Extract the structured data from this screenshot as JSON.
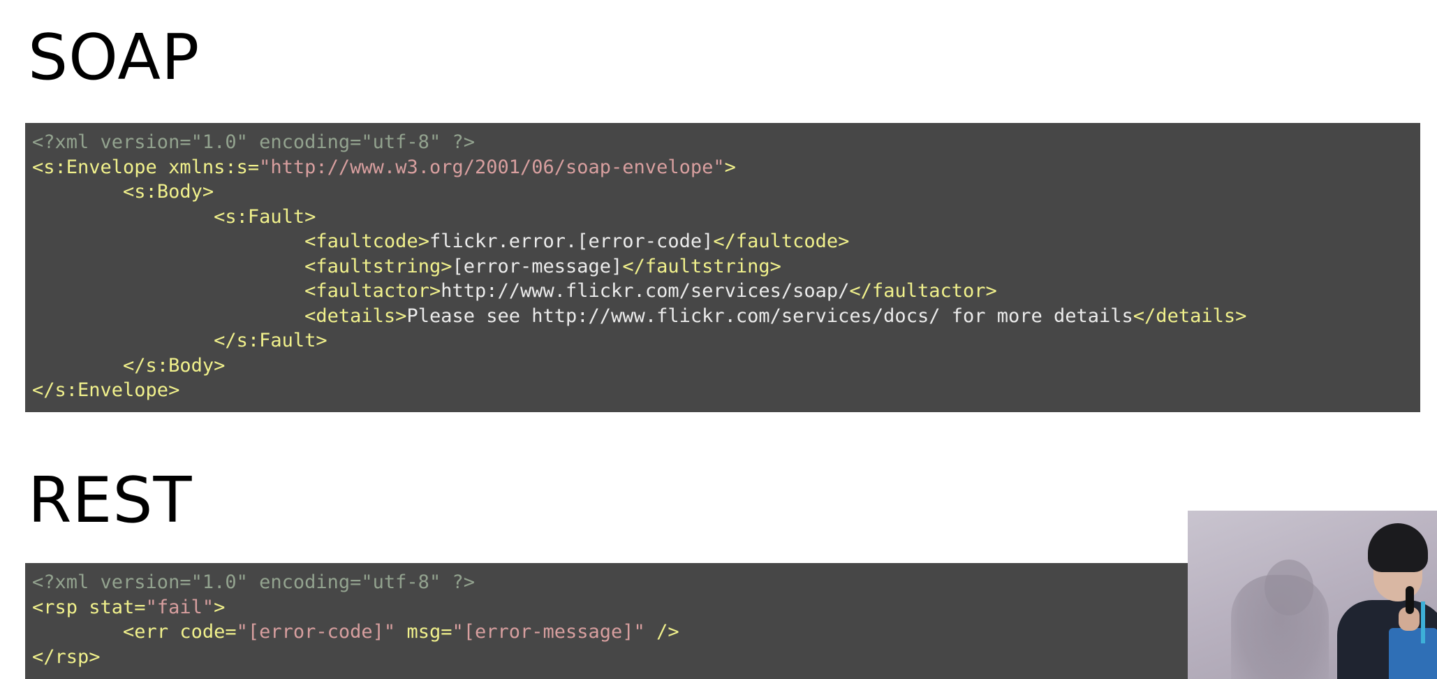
{
  "slide": {
    "soap_title": "SOAP",
    "rest_title": "REST"
  },
  "colors": {
    "code_background": "#474747",
    "declaration": "#93a38f",
    "tag": "#f1f18c",
    "string": "#d89f9f",
    "text": "#ececec"
  },
  "soap_code": {
    "lines": [
      [
        {
          "t": "<?xml version=\"1.0\" encoding=\"utf-8\" ?>",
          "c": "decl"
        }
      ],
      [
        {
          "t": "<s:Envelope ",
          "c": "tag"
        },
        {
          "t": "xmlns:s=",
          "c": "attr"
        },
        {
          "t": "\"http://www.w3.org/2001/06/soap-envelope\"",
          "c": "str"
        },
        {
          "t": ">",
          "c": "tag"
        }
      ],
      [
        {
          "t": "        ",
          "c": "text"
        },
        {
          "t": "<s:Body>",
          "c": "tag"
        }
      ],
      [
        {
          "t": "                ",
          "c": "text"
        },
        {
          "t": "<s:Fault>",
          "c": "tag"
        }
      ],
      [
        {
          "t": "                        ",
          "c": "text"
        },
        {
          "t": "<faultcode>",
          "c": "tag"
        },
        {
          "t": "flickr.error.[error-code]",
          "c": "text"
        },
        {
          "t": "</faultcode>",
          "c": "tag"
        }
      ],
      [
        {
          "t": "                        ",
          "c": "text"
        },
        {
          "t": "<faultstring>",
          "c": "tag"
        },
        {
          "t": "[error-message]",
          "c": "text"
        },
        {
          "t": "</faultstring>",
          "c": "tag"
        }
      ],
      [
        {
          "t": "                        ",
          "c": "text"
        },
        {
          "t": "<faultactor>",
          "c": "tag"
        },
        {
          "t": "http://www.flickr.com/services/soap/",
          "c": "text"
        },
        {
          "t": "</faultactor>",
          "c": "tag"
        }
      ],
      [
        {
          "t": "                        ",
          "c": "text"
        },
        {
          "t": "<details>",
          "c": "tag"
        },
        {
          "t": "Please see http://www.flickr.com/services/docs/ for more details",
          "c": "text"
        },
        {
          "t": "</details>",
          "c": "tag"
        }
      ],
      [
        {
          "t": "                ",
          "c": "text"
        },
        {
          "t": "</s:Fault>",
          "c": "tag"
        }
      ],
      [
        {
          "t": "        ",
          "c": "text"
        },
        {
          "t": "</s:Body>",
          "c": "tag"
        }
      ],
      [
        {
          "t": "</s:Envelope>",
          "c": "tag"
        }
      ]
    ]
  },
  "rest_code": {
    "lines": [
      [
        {
          "t": "<?xml version=\"1.0\" encoding=\"utf-8\" ?>",
          "c": "decl"
        }
      ],
      [
        {
          "t": "<rsp ",
          "c": "tag"
        },
        {
          "t": "stat=",
          "c": "attr"
        },
        {
          "t": "\"fail\"",
          "c": "str"
        },
        {
          "t": ">",
          "c": "tag"
        }
      ],
      [
        {
          "t": "        ",
          "c": "text"
        },
        {
          "t": "<err ",
          "c": "tag"
        },
        {
          "t": "code=",
          "c": "attr"
        },
        {
          "t": "\"[error-code]\"",
          "c": "str"
        },
        {
          "t": " msg=",
          "c": "attr"
        },
        {
          "t": "\"[error-message]\"",
          "c": "str"
        },
        {
          "t": " />",
          "c": "tag"
        }
      ],
      [
        {
          "t": "</rsp>",
          "c": "tag"
        }
      ]
    ]
  }
}
